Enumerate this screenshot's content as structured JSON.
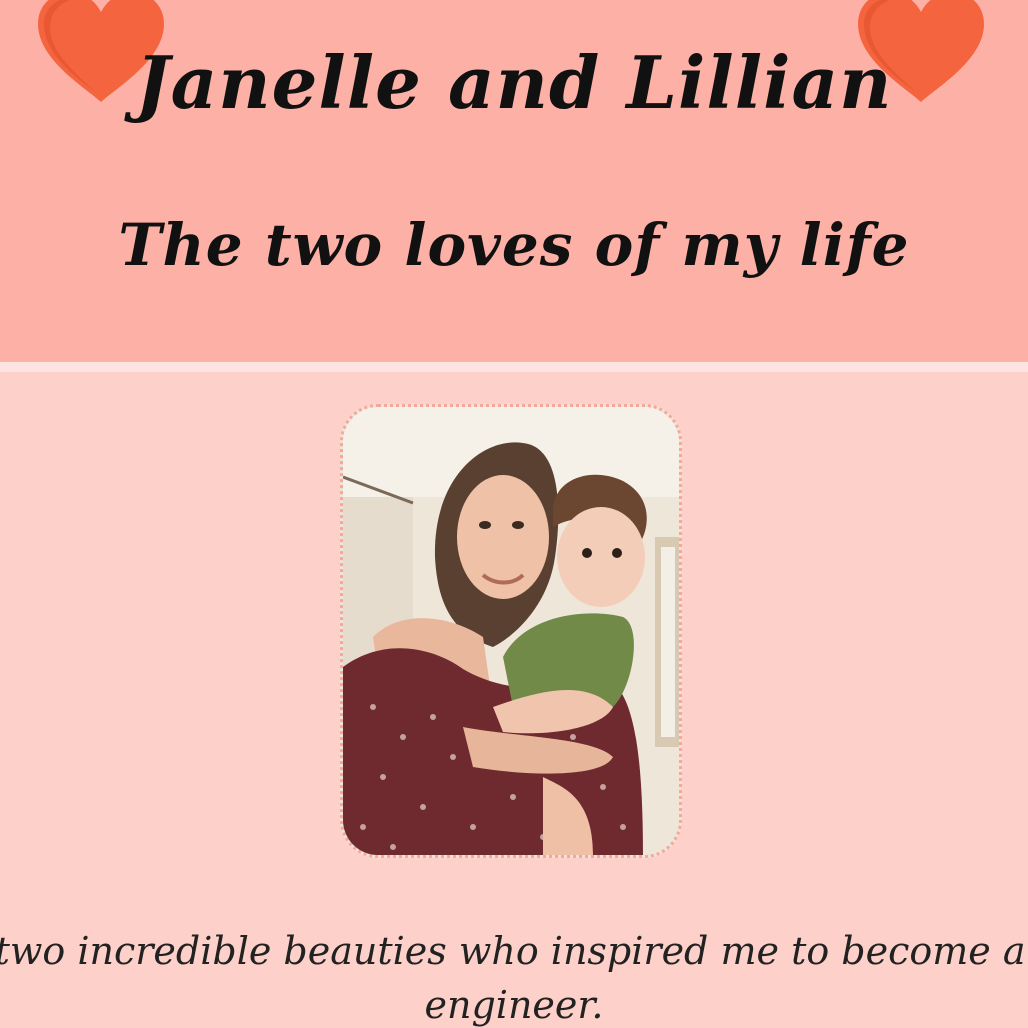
{
  "header": {
    "title": "Janelle and Lillian",
    "subtitle": "The two loves of my life",
    "heart_icon": "heart-icon",
    "heart_color": "#f4643f",
    "background": "#fdb1a6"
  },
  "main": {
    "background": "#fdd0c9",
    "photo": {
      "description_icon": "family-photo",
      "border_color": "#f5a79c"
    },
    "caption_line1": "e two incredible beauties who inspired me to become a softwa",
    "caption_line2": "engineer."
  }
}
